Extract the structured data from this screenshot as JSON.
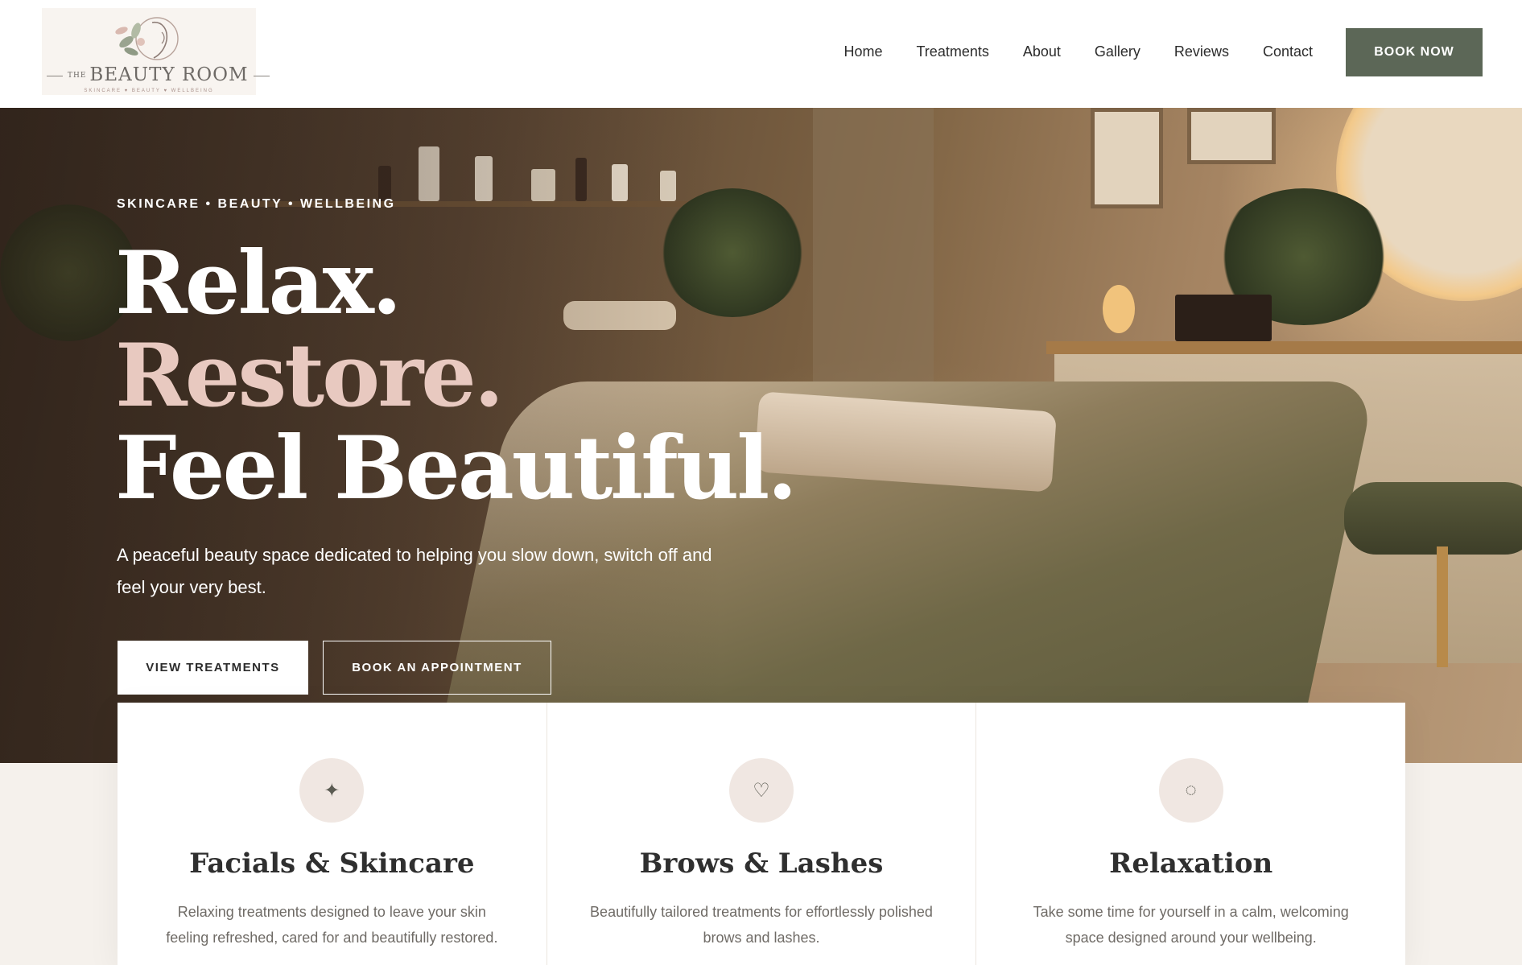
{
  "header": {
    "logo": {
      "the": "THE",
      "name": "BEAUTY ROOM",
      "tagline": "SKINCARE ♥ BEAUTY ♥ WELLBEING"
    },
    "nav": [
      "Home",
      "Treatments",
      "About",
      "Gallery",
      "Reviews",
      "Contact"
    ],
    "cta": "BOOK NOW",
    "cta_color": "#5c6757"
  },
  "hero": {
    "eyebrow": "SKINCARE • BEAUTY • WELLBEING",
    "headline": {
      "line1": "Relax.",
      "line2": "Restore.",
      "line3": "Feel Beautiful."
    },
    "accent_color": "#e8c9c0",
    "subtitle": "A peaceful beauty space dedicated to helping you slow down, switch off and feel your very best.",
    "primary_button": "VIEW TREATMENTS",
    "secondary_button": "BOOK AN APPOINTMENT"
  },
  "features": [
    {
      "icon": "sparkle-icon",
      "glyph": "✦",
      "title": "Facials & Skincare",
      "text": "Relaxing treatments designed to leave your skin feeling refreshed, cared for and beautifully restored."
    },
    {
      "icon": "heart-icon",
      "glyph": "♡",
      "title": "Brows & Lashes",
      "text": "Beautifully tailored treatments for effortlessly polished brows and lashes."
    },
    {
      "icon": "circle-icon",
      "glyph": "◌",
      "title": "Relaxation",
      "text": "Take some time for yourself in a calm, welcoming space designed around your wellbeing."
    }
  ]
}
